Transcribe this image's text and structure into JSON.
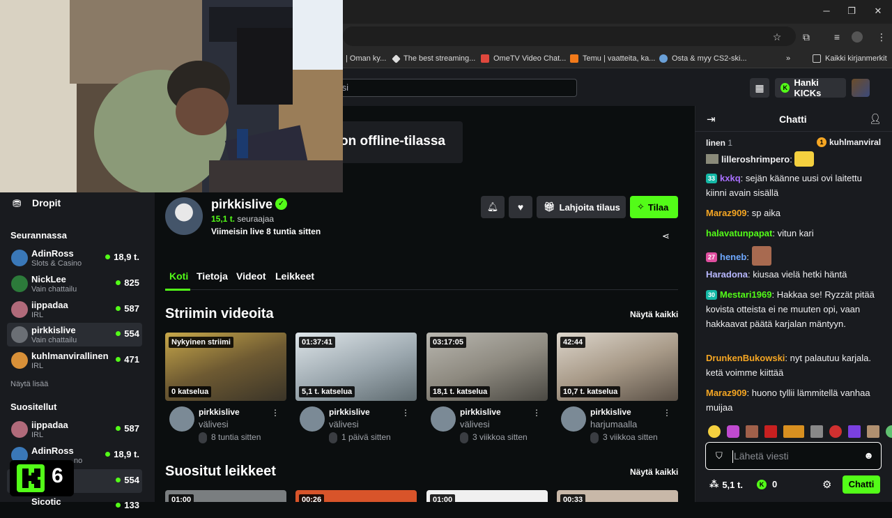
{
  "browser": {
    "bookmarks": [
      {
        "label": "| Oman ky...",
        "color": "#888888"
      },
      {
        "label": "The best streaming...",
        "color": "#dddddd"
      },
      {
        "label": "OmeTV Video Chat...",
        "color": "#e0483d"
      },
      {
        "label": "Temu | vaatteita, ka...",
        "color": "#f27a1a"
      },
      {
        "label": "Osta & myy CS2-ski...",
        "color": "#6aa0d8"
      }
    ],
    "bookmarks_overflow": "»",
    "all_bookmarks": "Kaikki kirjanmerkit"
  },
  "header": {
    "search_placeholder": "tsi",
    "kicks_label": "Hanki KICKs"
  },
  "offline_text": "on offline-tilassa",
  "sidebar": {
    "drops_label": "Dropit",
    "following_title": "Seurannassa",
    "following": [
      {
        "name": "AdinRoss",
        "category": "Slots & Casino",
        "viewers": "18,9 t.",
        "avatar": "#3a78b8"
      },
      {
        "name": "NickLee",
        "category": "Vain chattailu",
        "viewers": "825",
        "avatar": "#2c7a3a"
      },
      {
        "name": "iippadaa",
        "category": "IRL",
        "viewers": "587",
        "avatar": "#b06a7a"
      },
      {
        "name": "pirkkislive",
        "category": "Vain chattailu",
        "viewers": "554",
        "avatar": "#6b6f75"
      },
      {
        "name": "kuhlmanvirallinen",
        "category": "IRL",
        "viewers": "471",
        "avatar": "#d89038"
      }
    ],
    "show_more": "Näytä lisää",
    "recommended_title": "Suositellut",
    "recommended": [
      {
        "name": "iippadaa",
        "category": "IRL",
        "viewers": "587",
        "avatar": "#b06a7a"
      },
      {
        "name": "AdinRoss",
        "category": "no",
        "viewers": "18,9 t.",
        "avatar": "#3a78b8"
      },
      {
        "name": "",
        "category": "",
        "viewers": "554",
        "avatar": "#6b6f75"
      },
      {
        "name": "Sicotic",
        "category": "",
        "viewers": "133",
        "avatar": "#777777"
      }
    ],
    "k_overlay_number": "6"
  },
  "channel": {
    "name": "pirkkislive",
    "followers": "15,1 t.",
    "followers_label": "seuraajaa",
    "last_live": "Viimeisin live 8 tuntia sitten",
    "gift_label": "Lahjoita tilaus",
    "subscribe_label": "Tilaa",
    "tabs": [
      "Koti",
      "Tietoja",
      "Videot",
      "Leikkeet"
    ]
  },
  "videos_section": {
    "title": "Striimin videoita",
    "show_all": "Näytä kaikki",
    "cards": [
      {
        "badge": "Nykyinen striimi",
        "views": "0 katselua",
        "channel": "pirkkislive",
        "title": "välivesi",
        "meta": "8 tuntia sitten",
        "thumb": "#8a7a50"
      },
      {
        "badge": "01:37:41",
        "views": "5,1 t. katselua",
        "channel": "pirkkislive",
        "title": "välivesi",
        "meta": "1 päivä sitten",
        "thumb": "#a8b0b4"
      },
      {
        "badge": "03:17:05",
        "views": "18,1 t. katselua",
        "channel": "pirkkislive",
        "title": "välivesi",
        "meta": "3 viikkoa sitten",
        "thumb": "#8c8c86"
      },
      {
        "badge": "42:44",
        "views": "10,7 t. katselua",
        "channel": "pirkkislive",
        "title": "harjumaalla",
        "meta": "3 viikkoa sitten",
        "thumb": "#9a8e80"
      }
    ]
  },
  "clips_section": {
    "title": "Suositut leikkeet",
    "show_all": "Näytä kaikki",
    "badges": [
      "01:00",
      "00:26",
      "01:00",
      "00:33"
    ]
  },
  "chat": {
    "title": "Chatti",
    "pinned_left": "linen",
    "pinned_left_count": "1",
    "pinned_right_badge": "1",
    "pinned_right_name": "kuhlmanviral",
    "messages": [
      {
        "badge": "",
        "badge_color": "",
        "user": "lilleroshrimpero",
        "color": "#efeff1",
        "text": ""
      },
      {
        "badge": "33",
        "badge_color": "#14b8a6",
        "user": "kxkq",
        "color": "#a970ff",
        "text": "sejän käänne uusi ovi laitettu kiinni avain sisällä"
      },
      {
        "badge": "",
        "badge_color": "",
        "user": "Maraz909",
        "color": "#f5a623",
        "text": "sp aika"
      },
      {
        "badge": "",
        "badge_color": "",
        "user": "halavatunpapat",
        "color": "#53fc18",
        "text": "vitun kari"
      },
      {
        "badge": "27",
        "badge_color": "#e04fa0",
        "user": "heneb",
        "color": "#6ea8ff",
        "text": ""
      },
      {
        "badge": "",
        "badge_color": "",
        "user": "Haradona",
        "color": "#b8b8ff",
        "text": "kiusaa vielä hetki häntä"
      },
      {
        "badge": "30",
        "badge_color": "#14b8a6",
        "user": "Mestari1969",
        "color": "#53fc18",
        "text": "Hakkaa se! Ryzzät pitää kovista otteista ei ne muuten opi, vaan hakkaavat päätä karjalan mäntyyn."
      },
      {
        "badge": "",
        "badge_color": "",
        "user": "DrunkenBukowski",
        "color": "#f5a623",
        "text": "nyt palautuu karjala. ketä voimme kiittää"
      },
      {
        "badge": "",
        "badge_color": "",
        "user": "Maraz909",
        "color": "#f5a623",
        "text": "huono tyllii lämmitellä vanhaa muijaa"
      }
    ],
    "input_placeholder": "Lähetä viesti",
    "viewer_count": "5,1 t.",
    "kicks_count": "0",
    "send_label": "Chatti"
  }
}
